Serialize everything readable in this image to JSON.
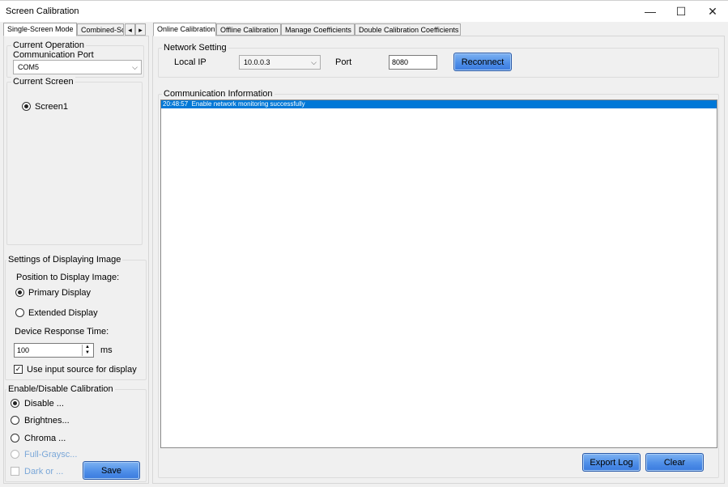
{
  "window": {
    "title": "Screen Calibration",
    "minimize_icon": "minimize-icon",
    "maximize_icon": "maximize-icon",
    "close_icon": "close-icon",
    "minimize_glyph": "—",
    "maximize_glyph": "☐",
    "close_glyph": "✕"
  },
  "left_tabs": {
    "items": [
      "Single-Screen Mode",
      "Combined-Sc"
    ],
    "scroll_left": "◂",
    "scroll_right": "▸"
  },
  "main_tabs": {
    "items": [
      "Online Calibration",
      "Offline Calibration",
      "Manage Coefficients",
      "Double Calibration Coefficients"
    ]
  },
  "current_operation": {
    "legend": "Current Operation",
    "port_label": "Communication Port",
    "port_value": "COM5"
  },
  "current_screen": {
    "legend": "Current Screen",
    "screens": [
      {
        "label": "Screen1",
        "selected": true
      }
    ]
  },
  "display_settings": {
    "legend": "Settings of Displaying Image",
    "position_label": "Position to Display Image:",
    "options": [
      {
        "label": "Primary Display",
        "selected": true
      },
      {
        "label": "Extended Display",
        "selected": false
      }
    ],
    "response_label": "Device Response Time:",
    "response_value": "100",
    "response_unit": "ms",
    "use_input_label": "Use input source for display",
    "use_input_checked": true
  },
  "calibration": {
    "legend": "Enable/Disable Calibration",
    "options": [
      {
        "label": "Disable ...",
        "selected": true,
        "enabled": true
      },
      {
        "label": "Brightnes...",
        "selected": false,
        "enabled": true
      },
      {
        "label": "Chroma ...",
        "selected": false,
        "enabled": true
      },
      {
        "label": "Full-Graysc...",
        "selected": false,
        "enabled": false
      }
    ],
    "dark_label": "Dark or ...",
    "save_label": "Save"
  },
  "network": {
    "legend": "Network Setting",
    "local_ip_label": "Local IP",
    "local_ip_value": "10.0.0.3",
    "port_label": "Port",
    "port_value": "8080",
    "reconnect_label": "Reconnect"
  },
  "communication": {
    "legend": "Communication Information",
    "log": [
      {
        "time": "20:48:57",
        "message": "Enable network monitoring successfully",
        "selected": true
      }
    ],
    "export_label": "Export Log",
    "clear_label": "Clear"
  },
  "colors": {
    "accent": "#0078d7",
    "button_blue": "#4f8fe8"
  }
}
